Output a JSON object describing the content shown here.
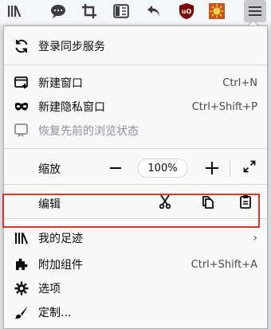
{
  "toolbar": {
    "icons": [
      "library-icon",
      "chat-icon",
      "crop-icon",
      "reader-view-icon",
      "back-arrow-icon",
      "ublock-icon",
      "settings-sun-icon",
      "hamburger-menu-icon"
    ]
  },
  "menu": {
    "sync": {
      "label": "登录同步服务",
      "icon": "sync-icon"
    },
    "new_window": {
      "label": "新建窗口",
      "shortcut": "Ctrl+N",
      "icon": "new-window-icon"
    },
    "private_window": {
      "label": "新建隐私窗口",
      "shortcut": "Ctrl+Shift+P",
      "icon": "private-mask-icon"
    },
    "restore_session": {
      "label": "恢复先前的浏览状态",
      "icon": "restore-icon",
      "disabled": true
    },
    "zoom": {
      "label": "缩放",
      "value": "100%",
      "minus": "−",
      "plus": "+",
      "fullscreen_icon": "fullscreen-icon"
    },
    "edit": {
      "label": "编辑",
      "cut_icon": "cut-icon",
      "copy_icon": "copy-icon",
      "paste_icon": "paste-icon"
    },
    "library": {
      "label": "我的足迹",
      "chevron": "›",
      "icon": "library-icon"
    },
    "addons": {
      "label": "附加组件",
      "shortcut": "Ctrl+Shift+A",
      "icon": "puzzle-icon"
    },
    "options": {
      "label": "选项",
      "icon": "gear-icon"
    },
    "customize": {
      "label": "定制...",
      "icon": "paintbrush-icon"
    }
  },
  "colors": {
    "highlight_border": "#e0342b",
    "ublock_red": "#800000",
    "addon_orange": "#c8541c"
  }
}
